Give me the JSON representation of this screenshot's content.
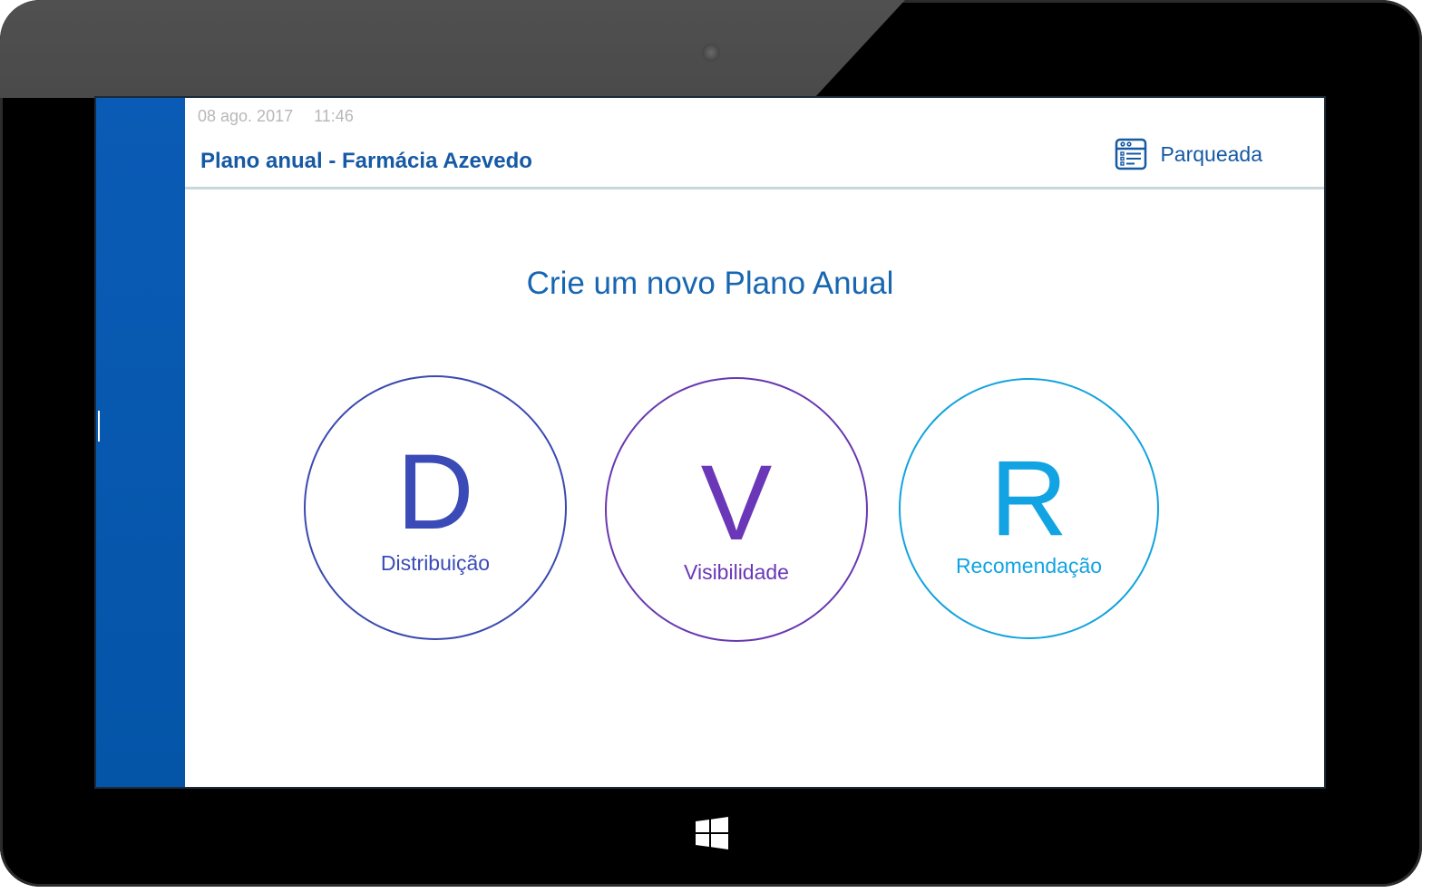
{
  "header": {
    "date": "08 ago. 2017",
    "time": "11:46",
    "title": "Plano anual - Farmácia Azevedo",
    "parked_label": "Parqueada",
    "parked_icon": "list-window-icon"
  },
  "main": {
    "heading": "Crie um novo Plano Anual",
    "options": [
      {
        "letter": "D",
        "label": "Distribuição",
        "color": "#3a4bb8"
      },
      {
        "letter": "V",
        "label": "Visibilidade",
        "color": "#6a37b8"
      },
      {
        "letter": "R",
        "label": "Recomendação",
        "color": "#12a3e3"
      }
    ]
  },
  "colors": {
    "sidebar": "#0455a8",
    "accent": "#1659a4"
  },
  "device": {
    "home_button_icon": "windows-logo-icon"
  }
}
